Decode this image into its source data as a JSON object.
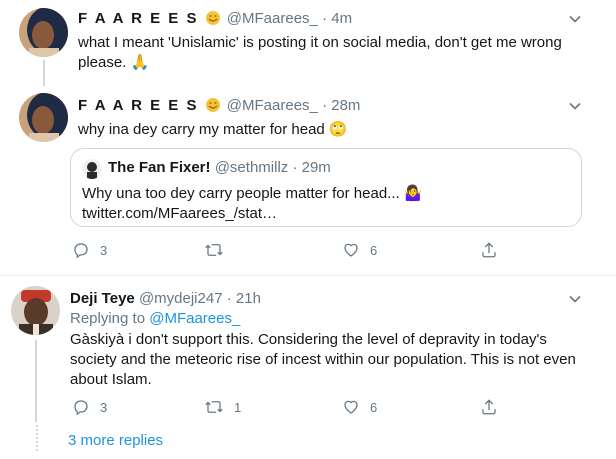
{
  "tweets": [
    {
      "name": "F A A R E E S",
      "handle": "@MFaarees_",
      "dot": "·",
      "time": "4m",
      "text": "what I meant 'Unislamic' is posting it on social media, don't get me wrong please. 🙏"
    },
    {
      "name": "F A A R E E S",
      "handle": "@MFaarees_",
      "dot": "·",
      "time": "28m",
      "text": "why ina dey carry my matter for head 🙄",
      "quote": {
        "name": "The Fan Fixer!",
        "handle": "@sethmillz",
        "dot": "·",
        "time": "29m",
        "text": "Why una too dey carry people matter for head... 🤷‍♀️",
        "link": "twitter.com/MFaarees_/stat…"
      },
      "actions": {
        "reply_count": "3",
        "retweet_count": "",
        "like_count": "6"
      }
    },
    {
      "name": "Deji Teye",
      "handle": "@mydeji247",
      "dot": "·",
      "time": "21h",
      "replying_prefix": "Replying to",
      "replying_to": "@MFaarees_",
      "text": "Gàskiyà i don't support this. Considering the level of depravity in today's society and the meteoric rise of incest within our population. This is not even about Islam.",
      "actions": {
        "reply_count": "3",
        "retweet_count": "1",
        "like_count": "6"
      }
    }
  ],
  "more_replies": "3 more replies",
  "colors": {
    "accent": "#1b95e0",
    "secondary_text": "#657786",
    "border": "#ccd6dd"
  },
  "icons": [
    "chevron-down-icon",
    "reply-icon",
    "retweet-icon",
    "like-icon",
    "share-icon",
    "verified-emoji-icon"
  ]
}
